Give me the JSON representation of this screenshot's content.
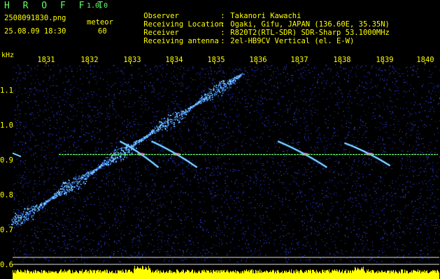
{
  "app": {
    "title": "H R O F F T",
    "version": "1.0.0"
  },
  "file": {
    "name": "2508091830.png",
    "timestamp": "25.08.09 18:30"
  },
  "mode": {
    "label": "meteor",
    "count": "60"
  },
  "info": [
    {
      "key": "Observer",
      "value": "Takanori Kawachi"
    },
    {
      "key": "Receiving Location",
      "value": "Ogaki, Gifu, JAPAN (136.60E, 35.35N)"
    },
    {
      "key": "Receiver",
      "value": "R820T2(RTL-SDR) SDR-Sharp 53.1000MHz"
    },
    {
      "key": "Receiving antenna",
      "value": "2el-HB9CV Vertical (el. E-W)"
    }
  ],
  "separator": ":",
  "axis": {
    "unit": "kHz",
    "time_labels": [
      "1831",
      "1832",
      "1833",
      "1834",
      "1835",
      "1836",
      "1837",
      "1838",
      "1839",
      "1840"
    ],
    "freq_labels": [
      "1.1",
      "1.0",
      "0.9",
      "0.8",
      "0.7",
      "0.6"
    ]
  },
  "colors": {
    "title": "#66ff66",
    "text": "#ffff00",
    "background": "#000000",
    "noise": "#1a1e7a",
    "carrier": "#66ff66",
    "meteor_trail": "#ff66ff",
    "reference_line": "#e0e0e0",
    "level_bar": "#ffff00"
  },
  "chart_data": {
    "type": "heatmap",
    "x_label": "",
    "y_label": "kHz",
    "x_ticks": [
      "1831",
      "1832",
      "1833",
      "1834",
      "1835",
      "1836",
      "1837",
      "1838",
      "1839",
      "1840"
    ],
    "y_ticks": [
      1.1,
      1.0,
      0.9,
      0.8,
      0.7,
      0.6
    ],
    "y_range": [
      0.6,
      1.15
    ],
    "carrier_frequency": 0.917,
    "reference_lines": [
      0.615,
      0.58
    ],
    "meteor_trails": [
      {
        "from": [
          "1832:45",
          0.955
        ],
        "to": [
          "1833:40",
          0.88
        ]
      },
      {
        "from": [
          "1833:30",
          0.955
        ],
        "to": [
          "1834:35",
          0.88
        ]
      },
      {
        "from": [
          "1836:30",
          0.955
        ],
        "to": [
          "1837:40",
          0.88
        ]
      },
      {
        "from": [
          "1838:05",
          0.95
        ],
        "to": [
          "1839:10",
          0.885
        ]
      }
    ],
    "interference_sweep": {
      "from": [
        "1830:00",
        0.72
      ],
      "to": [
        "1835:40",
        1.15
      ]
    }
  }
}
